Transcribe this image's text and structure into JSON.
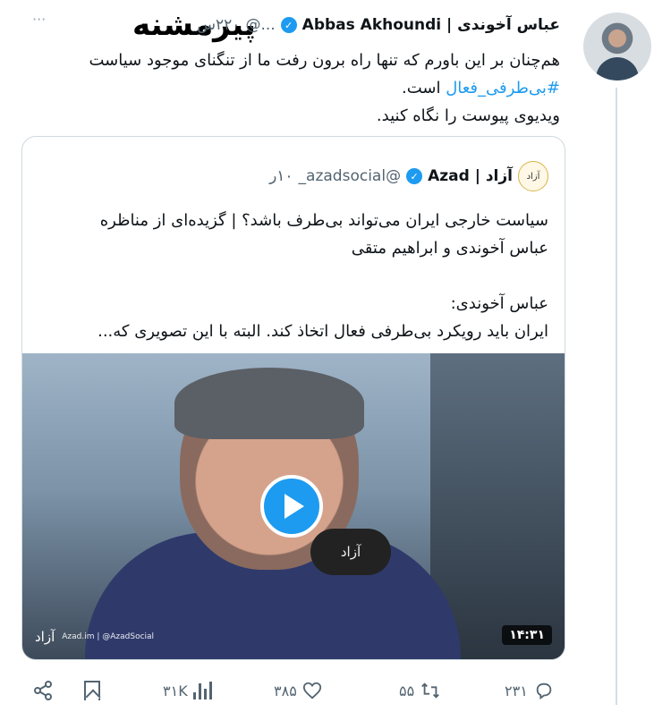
{
  "tweet": {
    "author_name": "عباس آخوندی | Abbas Akhoundi",
    "handle": "...@",
    "time": "۲۲۰س",
    "more_label": "···",
    "text_line1": "هم‌چنان بر این باورم که تنها راه برون رفت ما از تنگنای موجود سیاست",
    "hashtag": "#بی‌طرفی_فعال",
    "text_line2_suffix": "است.",
    "text_line3": "ویدیوی پیوست را نگاه کنید."
  },
  "watermark": "پیرمشنه",
  "quote": {
    "avatar_label": "آزاد",
    "author_name": "آزاد | Azad",
    "handle": "@azadsocial_",
    "time": "۱۰ر",
    "title_line1": "سیاست خارجی ایران می‌تواند بی‌طرف باشد؟ | گزیده‌ای از مناظره",
    "title_line2": "عباس آخوندی و ابراهیم متقی",
    "speaker": "عباس آخوندی:",
    "excerpt": "ایران باید رویکرد بی‌طرفی فعال اتخاذ کند. البته با این تصویری که...",
    "video": {
      "duration": "۱۴:۳۱",
      "mic_label": "آزاد",
      "brand_label": "آزاد",
      "brand_small": "Azad.im | @AzadSocial"
    }
  },
  "actions": {
    "replies": "۲۳۱",
    "retweets": "۵۵",
    "likes": "۳۸۵",
    "views": "۳۱K"
  },
  "colors": {
    "accent": "#1d9bf0",
    "secondary_text": "#536471",
    "divider": "#cfd9de"
  },
  "icons": [
    "more-icon",
    "verified-icon",
    "play-icon",
    "reply-icon",
    "retweet-icon",
    "like-icon",
    "views-icon",
    "bookmark-icon",
    "share-icon"
  ]
}
